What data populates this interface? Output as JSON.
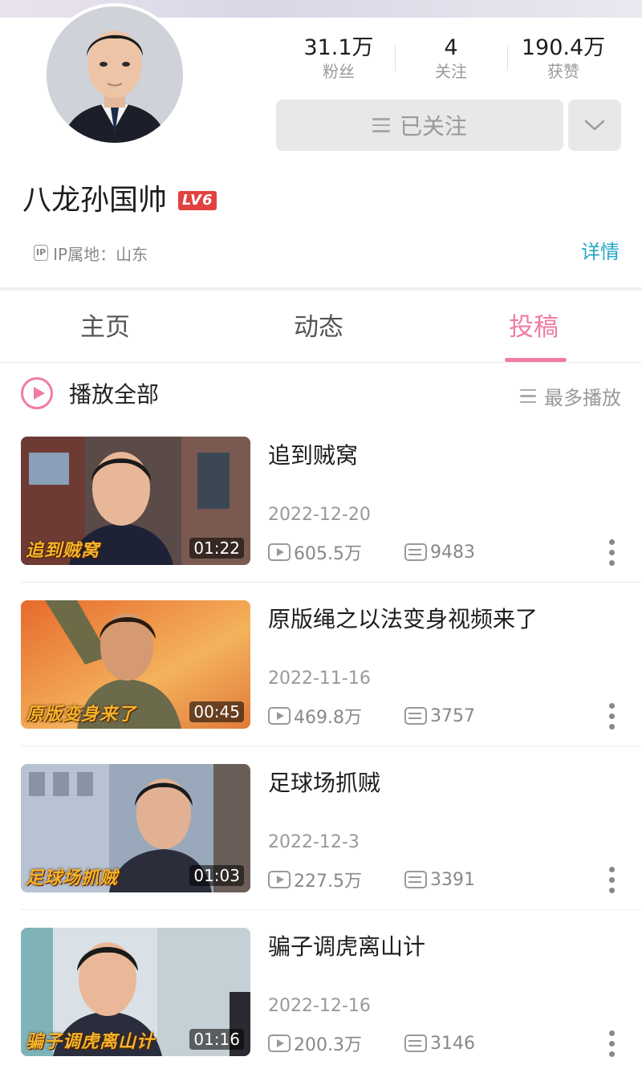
{
  "profile": {
    "name": "八龙孙国帅",
    "level_badge": "LV6",
    "ip_icon": "IP",
    "ip_location": "IP属地：山东",
    "detail_link": "详情",
    "stats": [
      {
        "value": "31.1万",
        "label": "粉丝"
      },
      {
        "value": "4",
        "label": "关注"
      },
      {
        "value": "190.4万",
        "label": "获赞"
      }
    ],
    "follow_label": "已关注"
  },
  "tabs": [
    {
      "label": "主页",
      "active": false
    },
    {
      "label": "动态",
      "active": false
    },
    {
      "label": "投稿",
      "active": true
    }
  ],
  "list_header": {
    "play_all": "播放全部",
    "sort_label": "最多播放"
  },
  "videos": [
    {
      "title": "追到贼窝",
      "date": "2022-12-20",
      "plays": "605.5万",
      "danmaku": "9483",
      "duration": "01:22",
      "caption": "追到贼窝"
    },
    {
      "title": "原版绳之以法变身视频来了",
      "date": "2022-11-16",
      "plays": "469.8万",
      "danmaku": "3757",
      "duration": "00:45",
      "caption": "原版变身来了"
    },
    {
      "title": "足球场抓贼",
      "date": "2022-12-3",
      "plays": "227.5万",
      "danmaku": "3391",
      "duration": "01:03",
      "caption": "足球场抓贼"
    },
    {
      "title": "骗子调虎离山计",
      "date": "2022-12-16",
      "plays": "200.3万",
      "danmaku": "3146",
      "duration": "01:16",
      "caption": "骗子调虎离山计"
    }
  ],
  "colors": {
    "accent_pink": "#f07ca4",
    "link_teal": "#26a6c5",
    "level_red": "#e1413f"
  },
  "icons": {
    "follow": "menu-lines-icon",
    "more": "chevron-down-icon",
    "ip": "ip-badge-icon",
    "play_all": "play-circle-icon",
    "sort": "sort-lines-icon",
    "plays": "play-box-icon",
    "danmaku": "danmaku-icon",
    "item_menu": "kebab-menu-icon"
  }
}
